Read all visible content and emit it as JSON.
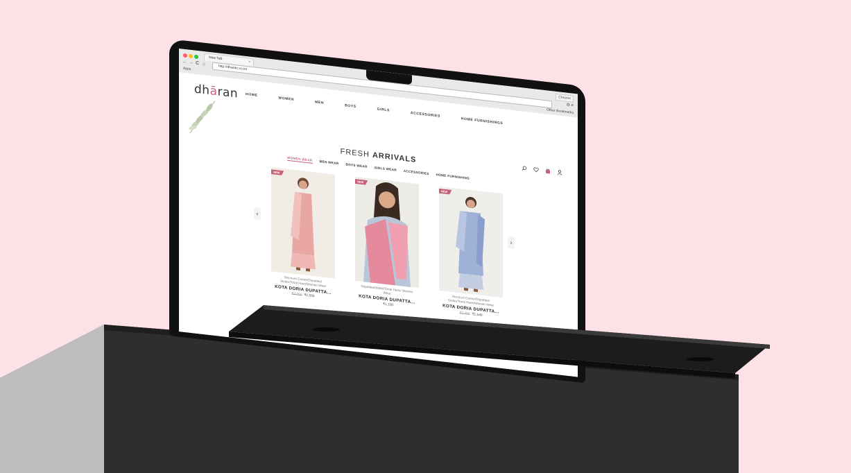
{
  "browser": {
    "tab_title": "New Tab",
    "tab_close": "×",
    "chrome_label": "Chrome",
    "url": "http://dharan.co.in/",
    "apps_label": "Apps",
    "bookmarks_label": "Other Bookmarks",
    "back": "←",
    "forward": "→",
    "reload": "C",
    "home": "⌂",
    "star": "☆",
    "settings": "⚙ ≡"
  },
  "site": {
    "logo_prefix": "dh",
    "logo_accent": "ā",
    "logo_suffix": "ran",
    "nav": [
      "HOME",
      "WOMEN",
      "MEN",
      "BOYS",
      "GIRLS",
      "ACCESSORIES",
      "HOME FURNISHINGS"
    ],
    "section_title_light": "FRESH ",
    "section_title_bold": "ARRIVALS",
    "categories": [
      "WOMEN WEAR",
      "MEN WEAR",
      "BOYS WEAR",
      "GIRLS WEAR",
      "ACCESSORIES",
      "HOME FURNISHING"
    ],
    "active_category": "WOMEN WEAR",
    "prev_arrow": "‹",
    "next_arrow": "›",
    "products": [
      {
        "badge": "NEW",
        "subtitle": "Discount Corner/Dupattas/ Stoles/Tonal Hues/Women Wear",
        "name": "KOTA DORIA DUPATTA...",
        "old_price": "₹2,200",
        "price": "₹1,550",
        "dress_color": "#e9a7a4"
      },
      {
        "badge": "NEW",
        "subtitle": "Dupattas/Stoles/Tonal Hues/ Women Wear",
        "name": "KOTA DORIA DUPATTA...",
        "old_price": "",
        "price": "₹1,100",
        "dress_color": "#e58a9d"
      },
      {
        "badge": "NEW",
        "subtitle": "Discount Corner/Dupattas/ Stoles/Tonal Hues/Women Wear",
        "name": "KOTA DORIA DUPATTA...",
        "old_price": "₹2,200",
        "price": "₹1,540",
        "dress_color": "#9fb1d6"
      }
    ]
  },
  "colors": {
    "background": "#fde1e6",
    "accent": "#c8607a",
    "plinth": "#2d2d2d"
  },
  "icons": [
    "search-icon",
    "heart-icon",
    "cart-icon",
    "user-icon",
    "leaf-icon"
  ]
}
